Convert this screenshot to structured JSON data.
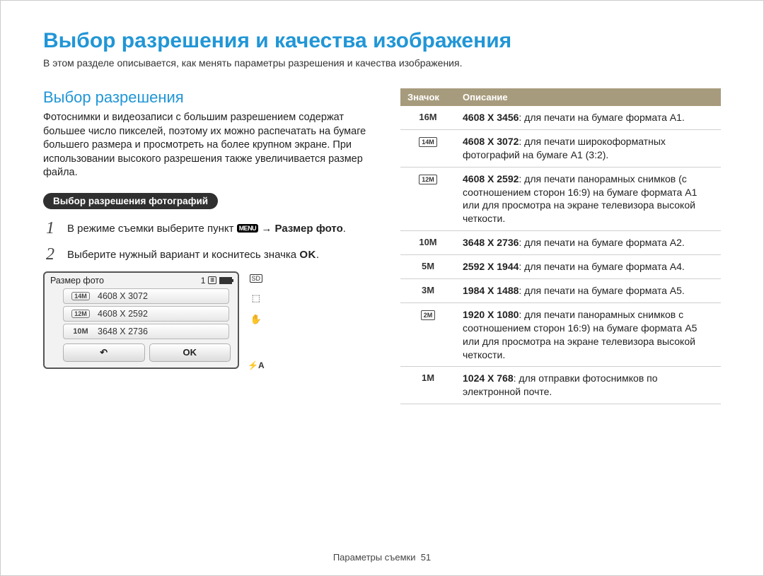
{
  "title": "Выбор разрешения и качества изображения",
  "intro": "В этом разделе описывается, как менять параметры разрешения и качества изображения.",
  "left": {
    "subtitle": "Выбор разрешения",
    "para": "Фотоснимки и видеозаписи с большим разрешением содержат большее число пикселей, поэтому их можно распечатать на бумаге большего размера и просмотреть на более крупном экране. При использовании высокого разрешения также увеличивается размер файла.",
    "pill": "Выбор разрешения фотографий",
    "step1_a": "В режиме съемки выберите пункт ",
    "step1_menu": "MENU",
    "step1_b": " → ",
    "step1_c": "Размер фото",
    "step1_d": ".",
    "step2_a": "Выберите нужный вариант и коснитесь значка ",
    "step2_ok": "OK",
    "step2_b": "."
  },
  "lcd": {
    "title": "Размер фото",
    "count": "1",
    "rows": [
      {
        "icon": "14M",
        "iconClass": "wide",
        "text": "4608 X 3072"
      },
      {
        "icon": "12M",
        "iconClass": "wide",
        "text": "4608 X 2592"
      },
      {
        "icon": "10M",
        "iconClass": "",
        "text": "3648 X 2736"
      }
    ],
    "back": "↶",
    "ok": "OK"
  },
  "side": {
    "sd": "SD",
    "rec": "⬚",
    "hand": "✋",
    "flash": "⚡A"
  },
  "table": {
    "head_icon": "Значок",
    "head_desc": "Описание",
    "rows": [
      {
        "icon": "16M",
        "iconBox": false,
        "dim": "4608 X 3456",
        "desc": ": для печати на бумаге формата A1."
      },
      {
        "icon": "14M",
        "iconBox": true,
        "dim": "4608 X 3072",
        "desc": ": для печати широкоформатных фотографий на бумаге A1 (3:2)."
      },
      {
        "icon": "12M",
        "iconBox": true,
        "dim": "4608 X 2592",
        "desc": ": для печати панорамных снимков (с соотношением сторон 16:9) на бумаге формата A1 или для просмотра на экране телевизора высокой четкости."
      },
      {
        "icon": "10M",
        "iconBox": false,
        "dim": "3648 X 2736",
        "desc": ": для печати на бумаге формата A2."
      },
      {
        "icon": "5M",
        "iconBox": false,
        "dim": "2592 X 1944",
        "desc": ": для печати на бумаге формата A4."
      },
      {
        "icon": "3M",
        "iconBox": false,
        "dim": "1984 X 1488",
        "desc": ": для печати на бумаге формата A5."
      },
      {
        "icon": "2M",
        "iconBox": true,
        "dim": "1920 X 1080",
        "desc": ": для печати панорамных снимков с соотношением сторон 16:9) на бумаге формата A5 или для просмотра на экране телевизора высокой четкости."
      },
      {
        "icon": "1M",
        "iconBox": false,
        "dim": "1024 X 768",
        "desc": ": для отправки фотоснимков по электронной почте."
      }
    ]
  },
  "footer_label": "Параметры съемки",
  "footer_num": "51"
}
